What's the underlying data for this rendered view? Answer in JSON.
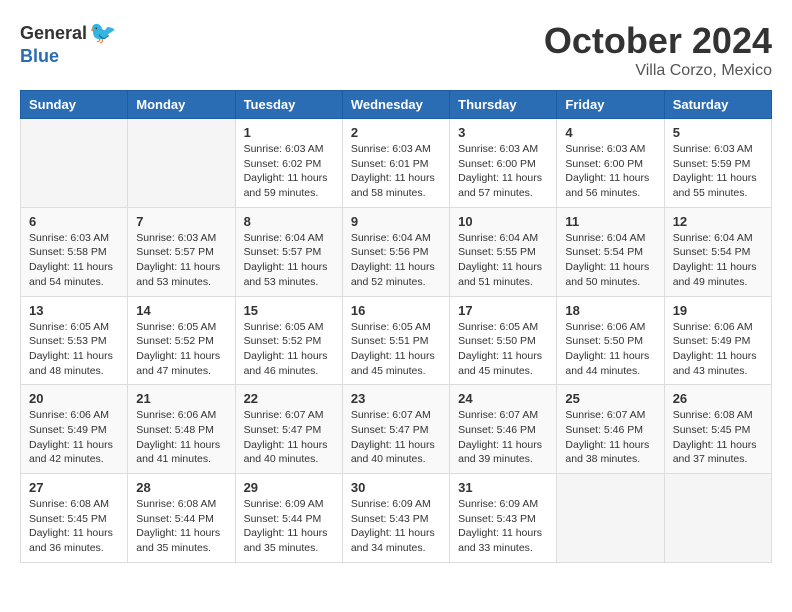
{
  "header": {
    "logo_general": "General",
    "logo_blue": "Blue",
    "month": "October 2024",
    "location": "Villa Corzo, Mexico"
  },
  "weekdays": [
    "Sunday",
    "Monday",
    "Tuesday",
    "Wednesday",
    "Thursday",
    "Friday",
    "Saturday"
  ],
  "weeks": [
    [
      {
        "day": "",
        "sunrise": "",
        "sunset": "",
        "daylight": ""
      },
      {
        "day": "",
        "sunrise": "",
        "sunset": "",
        "daylight": ""
      },
      {
        "day": "1",
        "sunrise": "Sunrise: 6:03 AM",
        "sunset": "Sunset: 6:02 PM",
        "daylight": "Daylight: 11 hours and 59 minutes."
      },
      {
        "day": "2",
        "sunrise": "Sunrise: 6:03 AM",
        "sunset": "Sunset: 6:01 PM",
        "daylight": "Daylight: 11 hours and 58 minutes."
      },
      {
        "day": "3",
        "sunrise": "Sunrise: 6:03 AM",
        "sunset": "Sunset: 6:00 PM",
        "daylight": "Daylight: 11 hours and 57 minutes."
      },
      {
        "day": "4",
        "sunrise": "Sunrise: 6:03 AM",
        "sunset": "Sunset: 6:00 PM",
        "daylight": "Daylight: 11 hours and 56 minutes."
      },
      {
        "day": "5",
        "sunrise": "Sunrise: 6:03 AM",
        "sunset": "Sunset: 5:59 PM",
        "daylight": "Daylight: 11 hours and 55 minutes."
      }
    ],
    [
      {
        "day": "6",
        "sunrise": "Sunrise: 6:03 AM",
        "sunset": "Sunset: 5:58 PM",
        "daylight": "Daylight: 11 hours and 54 minutes."
      },
      {
        "day": "7",
        "sunrise": "Sunrise: 6:03 AM",
        "sunset": "Sunset: 5:57 PM",
        "daylight": "Daylight: 11 hours and 53 minutes."
      },
      {
        "day": "8",
        "sunrise": "Sunrise: 6:04 AM",
        "sunset": "Sunset: 5:57 PM",
        "daylight": "Daylight: 11 hours and 53 minutes."
      },
      {
        "day": "9",
        "sunrise": "Sunrise: 6:04 AM",
        "sunset": "Sunset: 5:56 PM",
        "daylight": "Daylight: 11 hours and 52 minutes."
      },
      {
        "day": "10",
        "sunrise": "Sunrise: 6:04 AM",
        "sunset": "Sunset: 5:55 PM",
        "daylight": "Daylight: 11 hours and 51 minutes."
      },
      {
        "day": "11",
        "sunrise": "Sunrise: 6:04 AM",
        "sunset": "Sunset: 5:54 PM",
        "daylight": "Daylight: 11 hours and 50 minutes."
      },
      {
        "day": "12",
        "sunrise": "Sunrise: 6:04 AM",
        "sunset": "Sunset: 5:54 PM",
        "daylight": "Daylight: 11 hours and 49 minutes."
      }
    ],
    [
      {
        "day": "13",
        "sunrise": "Sunrise: 6:05 AM",
        "sunset": "Sunset: 5:53 PM",
        "daylight": "Daylight: 11 hours and 48 minutes."
      },
      {
        "day": "14",
        "sunrise": "Sunrise: 6:05 AM",
        "sunset": "Sunset: 5:52 PM",
        "daylight": "Daylight: 11 hours and 47 minutes."
      },
      {
        "day": "15",
        "sunrise": "Sunrise: 6:05 AM",
        "sunset": "Sunset: 5:52 PM",
        "daylight": "Daylight: 11 hours and 46 minutes."
      },
      {
        "day": "16",
        "sunrise": "Sunrise: 6:05 AM",
        "sunset": "Sunset: 5:51 PM",
        "daylight": "Daylight: 11 hours and 45 minutes."
      },
      {
        "day": "17",
        "sunrise": "Sunrise: 6:05 AM",
        "sunset": "Sunset: 5:50 PM",
        "daylight": "Daylight: 11 hours and 45 minutes."
      },
      {
        "day": "18",
        "sunrise": "Sunrise: 6:06 AM",
        "sunset": "Sunset: 5:50 PM",
        "daylight": "Daylight: 11 hours and 44 minutes."
      },
      {
        "day": "19",
        "sunrise": "Sunrise: 6:06 AM",
        "sunset": "Sunset: 5:49 PM",
        "daylight": "Daylight: 11 hours and 43 minutes."
      }
    ],
    [
      {
        "day": "20",
        "sunrise": "Sunrise: 6:06 AM",
        "sunset": "Sunset: 5:49 PM",
        "daylight": "Daylight: 11 hours and 42 minutes."
      },
      {
        "day": "21",
        "sunrise": "Sunrise: 6:06 AM",
        "sunset": "Sunset: 5:48 PM",
        "daylight": "Daylight: 11 hours and 41 minutes."
      },
      {
        "day": "22",
        "sunrise": "Sunrise: 6:07 AM",
        "sunset": "Sunset: 5:47 PM",
        "daylight": "Daylight: 11 hours and 40 minutes."
      },
      {
        "day": "23",
        "sunrise": "Sunrise: 6:07 AM",
        "sunset": "Sunset: 5:47 PM",
        "daylight": "Daylight: 11 hours and 40 minutes."
      },
      {
        "day": "24",
        "sunrise": "Sunrise: 6:07 AM",
        "sunset": "Sunset: 5:46 PM",
        "daylight": "Daylight: 11 hours and 39 minutes."
      },
      {
        "day": "25",
        "sunrise": "Sunrise: 6:07 AM",
        "sunset": "Sunset: 5:46 PM",
        "daylight": "Daylight: 11 hours and 38 minutes."
      },
      {
        "day": "26",
        "sunrise": "Sunrise: 6:08 AM",
        "sunset": "Sunset: 5:45 PM",
        "daylight": "Daylight: 11 hours and 37 minutes."
      }
    ],
    [
      {
        "day": "27",
        "sunrise": "Sunrise: 6:08 AM",
        "sunset": "Sunset: 5:45 PM",
        "daylight": "Daylight: 11 hours and 36 minutes."
      },
      {
        "day": "28",
        "sunrise": "Sunrise: 6:08 AM",
        "sunset": "Sunset: 5:44 PM",
        "daylight": "Daylight: 11 hours and 35 minutes."
      },
      {
        "day": "29",
        "sunrise": "Sunrise: 6:09 AM",
        "sunset": "Sunset: 5:44 PM",
        "daylight": "Daylight: 11 hours and 35 minutes."
      },
      {
        "day": "30",
        "sunrise": "Sunrise: 6:09 AM",
        "sunset": "Sunset: 5:43 PM",
        "daylight": "Daylight: 11 hours and 34 minutes."
      },
      {
        "day": "31",
        "sunrise": "Sunrise: 6:09 AM",
        "sunset": "Sunset: 5:43 PM",
        "daylight": "Daylight: 11 hours and 33 minutes."
      },
      {
        "day": "",
        "sunrise": "",
        "sunset": "",
        "daylight": ""
      },
      {
        "day": "",
        "sunrise": "",
        "sunset": "",
        "daylight": ""
      }
    ]
  ]
}
